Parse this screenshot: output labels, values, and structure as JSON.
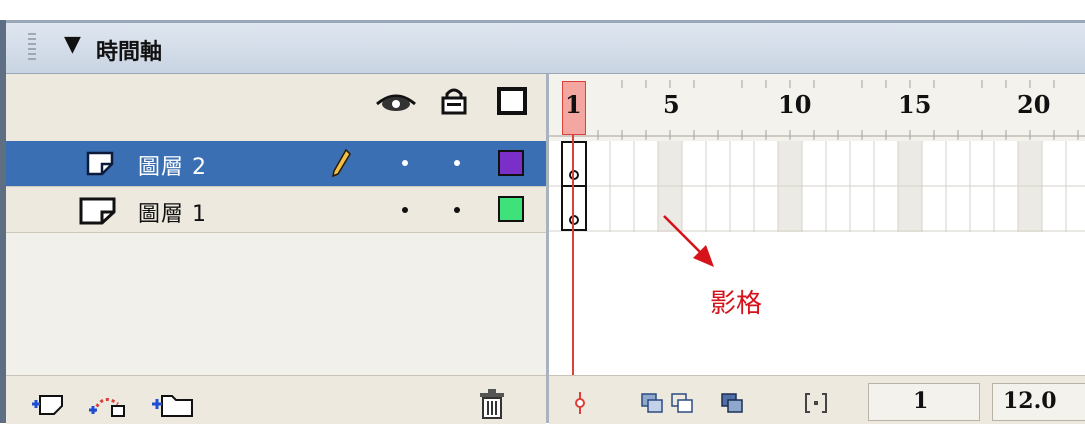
{
  "title_panel": {
    "title": "時間軸",
    "collapse_glyph": "▼"
  },
  "header_icons": [
    "eye-icon",
    "lock-icon",
    "outline-icon"
  ],
  "layers": [
    {
      "name": "圖層 2",
      "selected": true,
      "color": "#7a2fc9",
      "edit_icon": "pencil-icon"
    },
    {
      "name": "圖層 1",
      "selected": false,
      "color": "#3fe27a"
    }
  ],
  "ruler": {
    "labels": [
      "1",
      "5",
      "10",
      "15",
      "20"
    ]
  },
  "bottom_tools": {
    "left": [
      "add-layer-icon",
      "add-motion-guide-icon",
      "add-layer-folder-icon"
    ],
    "trash": "trash-icon",
    "timeline": [
      "center-frame-icon",
      "onion-skin-icon",
      "onion-skin-outlines-icon",
      "edit-multiple-frames-icon",
      "modify-onion-markers-icon"
    ]
  },
  "status": {
    "current_frame": "1",
    "frame_rate": "12.0"
  },
  "annotation": {
    "text": "影格",
    "color": "#d6121a"
  }
}
